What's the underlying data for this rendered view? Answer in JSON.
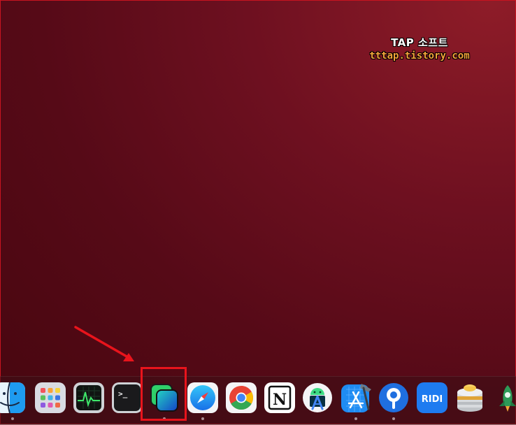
{
  "watermark": {
    "title": "TAP 소프트",
    "url": "tttap.tistory.com"
  },
  "colors": {
    "desktop": "#5a0b18",
    "highlight": "#e8141c",
    "watermark_url": "#f3a33a"
  },
  "dock": {
    "items": [
      {
        "icon": "finder-icon",
        "running": true
      },
      {
        "icon": "launchpad-icon",
        "running": false
      },
      {
        "icon": "activity-monitor-icon",
        "running": false
      },
      {
        "icon": "terminal-icon",
        "running": false
      },
      {
        "icon": "screens-app-icon",
        "running": true,
        "highlighted": true
      },
      {
        "icon": "safari-icon",
        "running": true
      },
      {
        "icon": "chrome-icon",
        "running": false
      },
      {
        "icon": "notion-icon",
        "running": false
      },
      {
        "icon": "android-studio-icon",
        "running": false
      },
      {
        "icon": "xcode-icon",
        "running": true
      },
      {
        "icon": "sourcetree-icon",
        "running": true
      },
      {
        "icon": "ridi-icon",
        "running": false
      },
      {
        "icon": "sequel-pro-icon",
        "running": false
      },
      {
        "icon": "rocket-icon",
        "running": false
      }
    ],
    "ridi_label": "RIDI",
    "notion_letter": "N",
    "terminal_prompt": ">_"
  }
}
